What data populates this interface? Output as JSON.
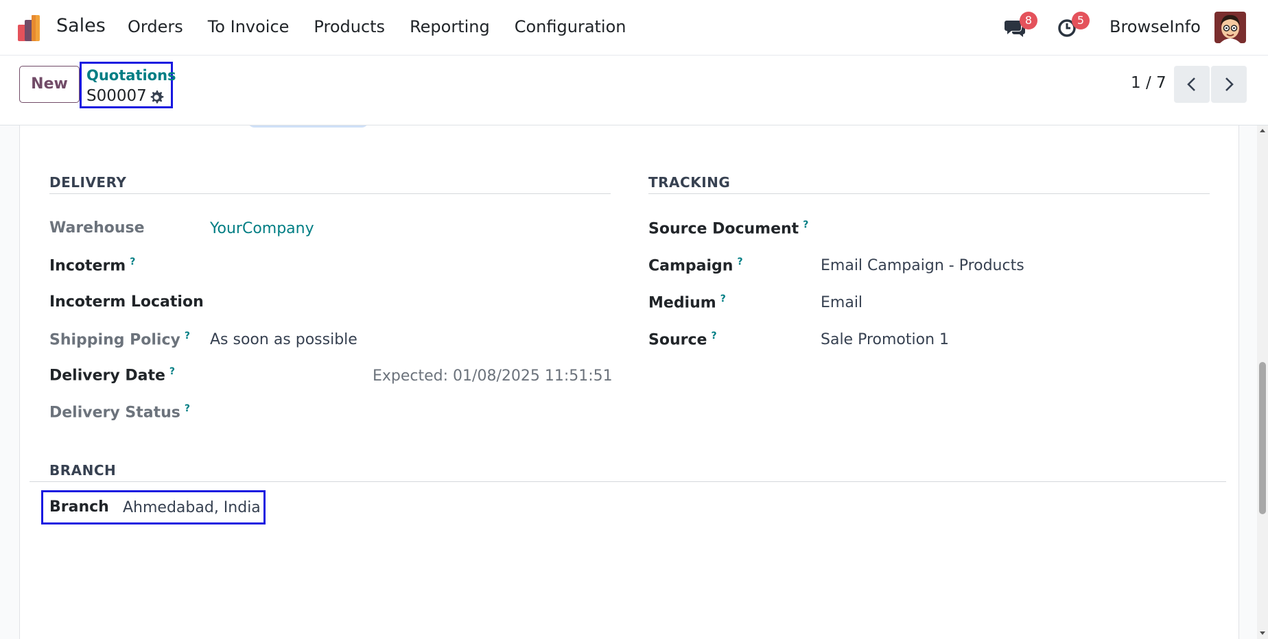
{
  "navbar": {
    "app_name": "Sales",
    "menu": [
      "Orders",
      "To Invoice",
      "Products",
      "Reporting",
      "Configuration"
    ],
    "messages_count": "8",
    "activities_count": "5",
    "user_name": "BrowseInfo",
    "badge_color": "#e4525b"
  },
  "control_panel": {
    "new_label": "New",
    "breadcrumb": "Quotations",
    "record_name": "S00007",
    "pager": "1 / 7"
  },
  "delivery": {
    "title": "DELIVERY",
    "warehouse_label": "Warehouse",
    "warehouse_value": "YourCompany",
    "incoterm_label": "Incoterm",
    "incoterm_location_label": "Incoterm Location",
    "shipping_policy_label": "Shipping Policy",
    "shipping_policy_value": "As soon as possible",
    "delivery_date_label": "Delivery Date",
    "delivery_date_expected": "Expected: 01/08/2025 11:51:51",
    "delivery_status_label": "Delivery Status"
  },
  "tracking": {
    "title": "TRACKING",
    "source_document_label": "Source Document",
    "campaign_label": "Campaign",
    "campaign_value": "Email Campaign - Products",
    "medium_label": "Medium",
    "medium_value": "Email",
    "source_label": "Source",
    "source_value": "Sale Promotion 1"
  },
  "branch": {
    "title": "BRANCH",
    "branch_label": "Branch",
    "branch_value": "Ahmedabad, India"
  },
  "help_mark": "?",
  "colors": {
    "accent": "#017e84",
    "brand": "#714b67",
    "highlight": "#1818e0"
  }
}
